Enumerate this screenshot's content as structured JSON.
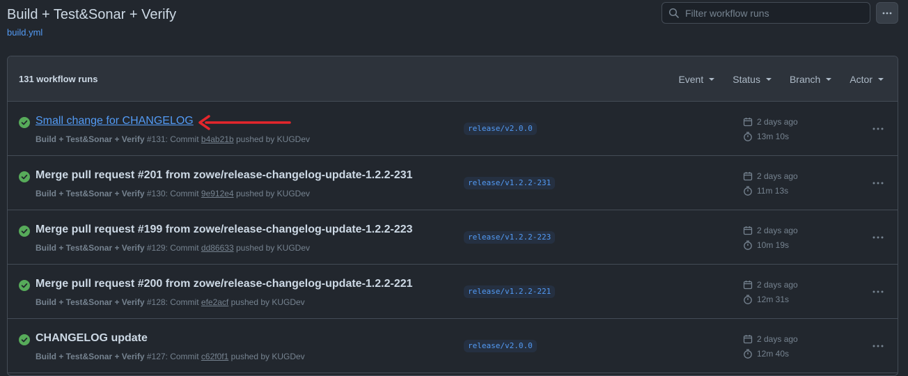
{
  "page": {
    "title": "Build + Test&Sonar + Verify",
    "file_link": "build.yml",
    "filter_placeholder": "Filter workflow runs"
  },
  "runs_header": {
    "count": "131 workflow runs",
    "filters": [
      "Event",
      "Status",
      "Branch",
      "Actor"
    ]
  },
  "colors": {
    "success": "#57ab5a",
    "link": "#539bf5",
    "annotation_arrow": "#e5262c"
  },
  "runs": [
    {
      "title": "Small change for CHANGELOG",
      "workflow": "Build + Test&Sonar + Verify",
      "number": "#131",
      "commit_label": "Commit",
      "sha": "b4ab21b",
      "pushed_by": "pushed by KUGDev",
      "branch": "release/v2.0.0",
      "date": "2 days ago",
      "duration": "13m 10s",
      "status_icon": "check-circle-icon"
    },
    {
      "title": "Merge pull request #201 from zowe/release-changelog-update-1.2.2-231",
      "workflow": "Build + Test&Sonar + Verify",
      "number": "#130",
      "commit_label": "Commit",
      "sha": "9e912e4",
      "pushed_by": "pushed by KUGDev",
      "branch": "release/v1.2.2-231",
      "date": "2 days ago",
      "duration": "11m 13s",
      "status_icon": "check-circle-icon"
    },
    {
      "title": "Merge pull request #199 from zowe/release-changelog-update-1.2.2-223",
      "workflow": "Build + Test&Sonar + Verify",
      "number": "#129",
      "commit_label": "Commit",
      "sha": "dd86633",
      "pushed_by": "pushed by KUGDev",
      "branch": "release/v1.2.2-223",
      "date": "2 days ago",
      "duration": "10m 19s",
      "status_icon": "check-circle-icon"
    },
    {
      "title": "Merge pull request #200 from zowe/release-changelog-update-1.2.2-221",
      "workflow": "Build + Test&Sonar + Verify",
      "number": "#128",
      "commit_label": "Commit",
      "sha": "efe2acf",
      "pushed_by": "pushed by KUGDev",
      "branch": "release/v1.2.2-221",
      "date": "2 days ago",
      "duration": "12m 31s",
      "status_icon": "check-circle-icon"
    },
    {
      "title": "CHANGELOG update",
      "workflow": "Build + Test&Sonar + Verify",
      "number": "#127",
      "commit_label": "Commit",
      "sha": "c62f0f1",
      "pushed_by": "pushed by KUGDev",
      "branch": "release/v2.0.0",
      "date": "2 days ago",
      "duration": "12m 40s",
      "status_icon": "check-circle-icon"
    }
  ]
}
